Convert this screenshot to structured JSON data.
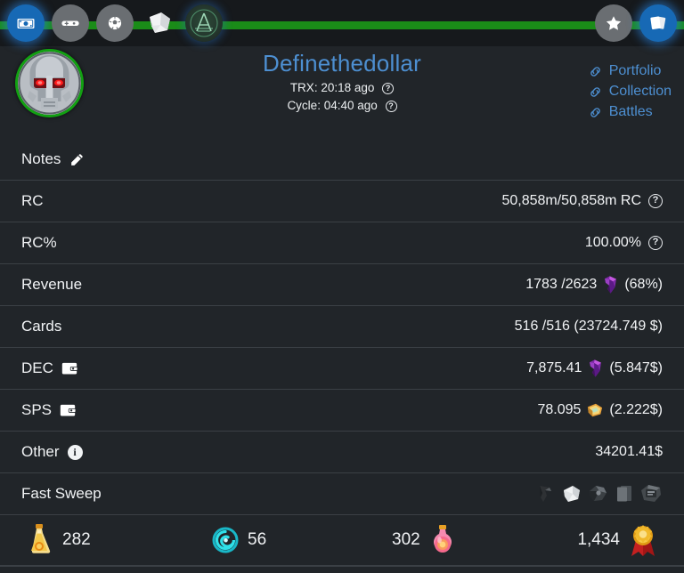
{
  "topbar": {
    "progress_percent": 100,
    "progress_color": "#1a8c18",
    "left_icons": [
      {
        "name": "money-icon",
        "label": "Money",
        "active": true
      },
      {
        "name": "gamepad-icon",
        "label": "Game",
        "active": false
      },
      {
        "name": "soccer-ball-icon",
        "label": "Ball",
        "active": false
      },
      {
        "name": "paper-scroll-icon",
        "label": "Scroll",
        "active": false
      },
      {
        "name": "archmage-a-icon",
        "label": "A",
        "active": false
      }
    ],
    "right_icons": [
      {
        "name": "star-icon",
        "label": "Star",
        "active": false
      },
      {
        "name": "cards-icon",
        "label": "Cards",
        "active": true
      }
    ]
  },
  "header": {
    "avatar_name": "robot-avatar",
    "username": "Definethedollar",
    "trx_label": "TRX:",
    "trx_value": "20:18 ago",
    "cycle_label": "Cycle:",
    "cycle_value": "04:40 ago",
    "help_glyph": "?",
    "links": [
      {
        "label": "Portfolio",
        "icon": "chain-link-icon"
      },
      {
        "label": "Collection",
        "icon": "chain-link-icon"
      },
      {
        "label": "Battles",
        "icon": "chain-link-icon"
      }
    ],
    "link_color": "#4d8fd1"
  },
  "table": {
    "rows": [
      {
        "label": "Notes",
        "icon": "pencil-edit-icon",
        "value": ""
      },
      {
        "label": "RC",
        "value": "50,858m/50,858m RC",
        "help": "?"
      },
      {
        "label": "RC%",
        "value": "100.00%",
        "help": "?"
      },
      {
        "label": "Revenue",
        "value": "1783 /2623",
        "gem": true,
        "suffix": "(68%)"
      },
      {
        "label": "Cards",
        "value": "516 /516 (23724.749 $)"
      },
      {
        "label": "DEC",
        "icon": "wallet-icon",
        "value": "7,875.41",
        "gem": true,
        "suffix": "(5.847$)"
      },
      {
        "label": "SPS",
        "icon": "wallet-icon",
        "value": "78.095",
        "coin": true,
        "suffix": "(2.222$)"
      },
      {
        "label": "Other",
        "icon": "info-icon",
        "value": "34201.41$"
      },
      {
        "label": "Fast Sweep",
        "value": "",
        "sweep_icons": [
          "sweep-beta-icon",
          "sweep-untamed-icon",
          "sweep-chaos-icon",
          "sweep-pack-icon",
          "sweep-rebellion-icon"
        ]
      }
    ]
  },
  "stats": [
    {
      "icon": "gold-potion-icon",
      "value": "282",
      "order": "icon-first"
    },
    {
      "icon": "voucher-spiral-icon",
      "value": "56",
      "order": "icon-first"
    },
    {
      "icon": "pink-potion-icon",
      "value": "302",
      "order": "value-first"
    },
    {
      "icon": "gold-medal-icon",
      "value": "1,434",
      "order": "value-first"
    }
  ],
  "colors": {
    "background": "#212529",
    "topbar": "#16191c",
    "divider": "#3b4045",
    "accent_blue": "#4d8fd1",
    "accent_green": "#12a112",
    "text": "#f1f3f5"
  }
}
